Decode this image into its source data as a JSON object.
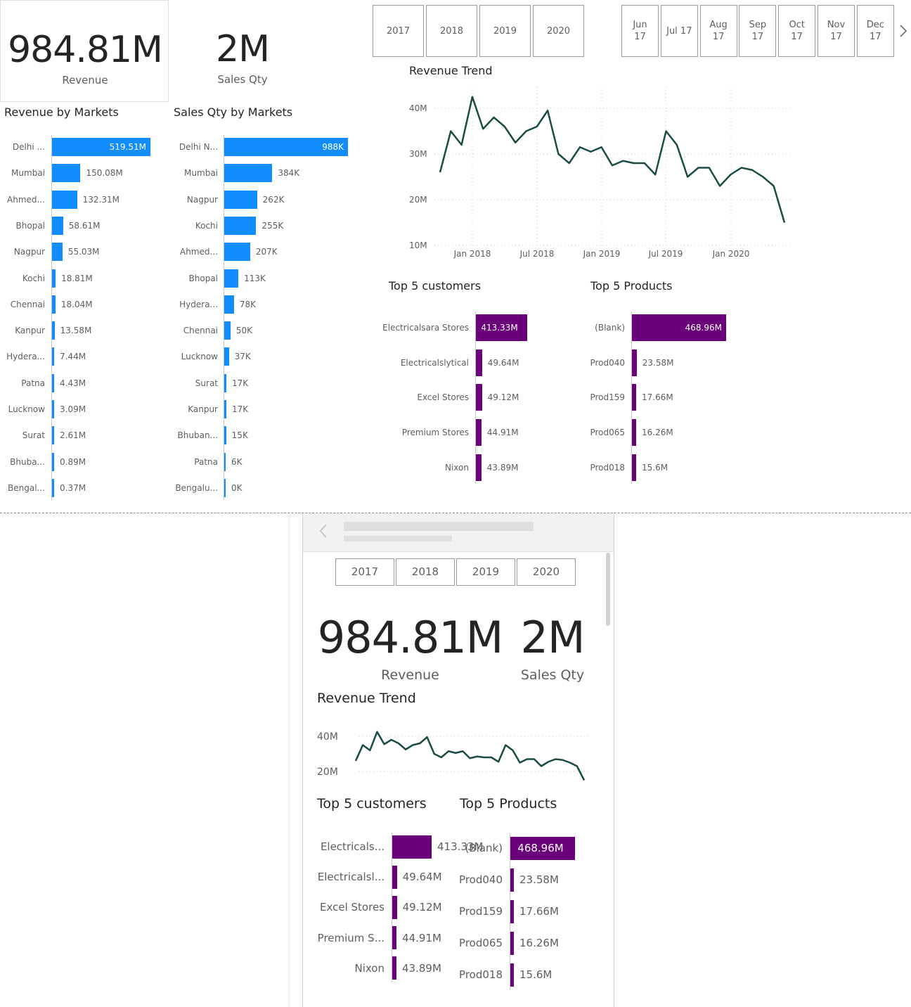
{
  "kpis": {
    "revenue_value": "984.81M",
    "revenue_label": "Revenue",
    "qty_value": "2M",
    "qty_label": "Sales Qty"
  },
  "year_slicer": [
    "2017",
    "2018",
    "2019",
    "2020"
  ],
  "month_slicer": {
    "items": [
      {
        "line1": "Jun",
        "line2": "17"
      },
      {
        "line1": "Jul 17",
        "line2": ""
      },
      {
        "line1": "Aug",
        "line2": "17"
      },
      {
        "line1": "Sep",
        "line2": "17"
      },
      {
        "line1": "Oct",
        "line2": "17"
      },
      {
        "line1": "Nov",
        "line2": "17"
      },
      {
        "line1": "Dec",
        "line2": "17"
      }
    ],
    "next_icon": "chevron-right-icon"
  },
  "revenue_by_markets": {
    "title": "Revenue by Markets",
    "color": "#118dff",
    "max": 519.51,
    "rows": [
      {
        "label": "Delhi ...",
        "value": 519.51,
        "text": "519.51M"
      },
      {
        "label": "Mumbai",
        "value": 150.08,
        "text": "150.08M"
      },
      {
        "label": "Ahmed...",
        "value": 132.31,
        "text": "132.31M"
      },
      {
        "label": "Bhopal",
        "value": 58.61,
        "text": "58.61M"
      },
      {
        "label": "Nagpur",
        "value": 55.03,
        "text": "55.03M"
      },
      {
        "label": "Kochi",
        "value": 18.81,
        "text": "18.81M"
      },
      {
        "label": "Chennai",
        "value": 18.04,
        "text": "18.04M"
      },
      {
        "label": "Kanpur",
        "value": 13.58,
        "text": "13.58M"
      },
      {
        "label": "Hydera...",
        "value": 7.44,
        "text": "7.44M"
      },
      {
        "label": "Patna",
        "value": 4.43,
        "text": "4.43M"
      },
      {
        "label": "Lucknow",
        "value": 3.09,
        "text": "3.09M"
      },
      {
        "label": "Surat",
        "value": 2.61,
        "text": "2.61M"
      },
      {
        "label": "Bhuba...",
        "value": 0.89,
        "text": "0.89M"
      },
      {
        "label": "Bengal...",
        "value": 0.37,
        "text": "0.37M"
      }
    ]
  },
  "qty_by_markets": {
    "title": "Sales Qty by Markets",
    "color": "#118dff",
    "max": 988,
    "rows": [
      {
        "label": "Delhi N...",
        "value": 988,
        "text": "988K"
      },
      {
        "label": "Mumbai",
        "value": 384,
        "text": "384K"
      },
      {
        "label": "Nagpur",
        "value": 262,
        "text": "262K"
      },
      {
        "label": "Kochi",
        "value": 255,
        "text": "255K"
      },
      {
        "label": "Ahmed...",
        "value": 207,
        "text": "207K"
      },
      {
        "label": "Bhopal",
        "value": 113,
        "text": "113K"
      },
      {
        "label": "Hydera...",
        "value": 78,
        "text": "78K"
      },
      {
        "label": "Chennai",
        "value": 50,
        "text": "50K"
      },
      {
        "label": "Lucknow",
        "value": 37,
        "text": "37K"
      },
      {
        "label": "Surat",
        "value": 17,
        "text": "17K"
      },
      {
        "label": "Kanpur",
        "value": 17,
        "text": "17K"
      },
      {
        "label": "Bhuban...",
        "value": 15,
        "text": "15K"
      },
      {
        "label": "Patna",
        "value": 6,
        "text": "6K"
      },
      {
        "label": "Bengalu...",
        "value": 0.4,
        "text": "0K"
      }
    ]
  },
  "chart_data": {
    "type": "line",
    "title": "Revenue Trend",
    "xlabel": "",
    "ylabel": "",
    "x_ticks": [
      "Jan 2018",
      "Jul 2018",
      "Jan 2019",
      "Jul 2019",
      "Jan 2020"
    ],
    "y_ticks": [
      "10M",
      "20M",
      "30M",
      "40M"
    ],
    "ylim": [
      10,
      44
    ],
    "mobile_y_ticks": [
      "20M",
      "40M"
    ],
    "color": "#1b4b45",
    "grid": true,
    "series": [
      {
        "values": [
          26.0,
          35.0,
          32.0,
          42.5,
          35.5,
          38.0,
          36.0,
          32.5,
          35.0,
          36.0,
          39.5,
          30.0,
          28.0,
          31.5,
          30.5,
          31.5,
          27.5,
          28.5,
          28.0,
          28.0,
          25.5,
          35.0,
          32.0,
          25.0,
          27.0,
          27.0,
          23.0,
          25.5,
          27.0,
          26.5,
          25.0,
          23.0,
          15.0
        ]
      }
    ]
  },
  "top_customers": {
    "title": "Top 5 customers",
    "color": "#6b007b",
    "max": 413.33,
    "rows": [
      {
        "label": "Electricalsara Stores",
        "mlabel": "Electricals...",
        "value": 413.33,
        "text": "413.33M"
      },
      {
        "label": "Electricalslytical",
        "mlabel": "Electricalsl...",
        "value": 49.64,
        "text": "49.64M"
      },
      {
        "label": "Excel Stores",
        "mlabel": "Excel Stores",
        "value": 49.12,
        "text": "49.12M"
      },
      {
        "label": "Premium Stores",
        "mlabel": "Premium S...",
        "value": 44.91,
        "text": "44.91M"
      },
      {
        "label": "Nixon",
        "mlabel": "Nixon",
        "value": 43.89,
        "text": "43.89M"
      }
    ]
  },
  "top_products": {
    "title": "Top 5 Products",
    "color": "#6b007b",
    "max": 468.96,
    "rows": [
      {
        "label": "(Blank)",
        "value": 468.96,
        "text": "468.96M"
      },
      {
        "label": "Prod040",
        "value": 23.58,
        "text": "23.58M"
      },
      {
        "label": "Prod159",
        "value": 17.66,
        "text": "17.66M"
      },
      {
        "label": "Prod065",
        "value": 16.26,
        "text": "16.26M"
      },
      {
        "label": "Prod018",
        "value": 15.6,
        "text": "15.6M"
      }
    ]
  },
  "mobile": {
    "back_icon": "chevron-left-icon"
  }
}
